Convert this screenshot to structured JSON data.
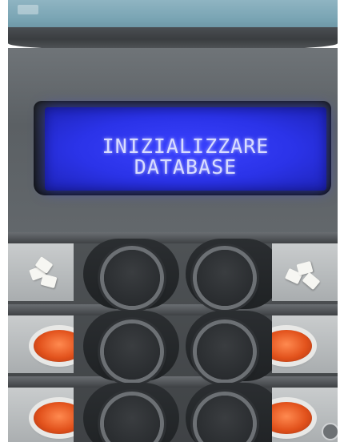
{
  "display": {
    "line1": "INIZIALIZZARE",
    "line2": "DATABASE",
    "backlight_color": "#2b33e8"
  },
  "buttons": {
    "count": 6,
    "rows": [
      {
        "left_icon": "sugar-icon",
        "right_icon": "sugar-icon"
      },
      {
        "left_icon": "cup-icon",
        "right_icon": "cup-icon"
      },
      {
        "left_icon": "cup-icon",
        "right_icon": "cup-icon"
      }
    ]
  }
}
